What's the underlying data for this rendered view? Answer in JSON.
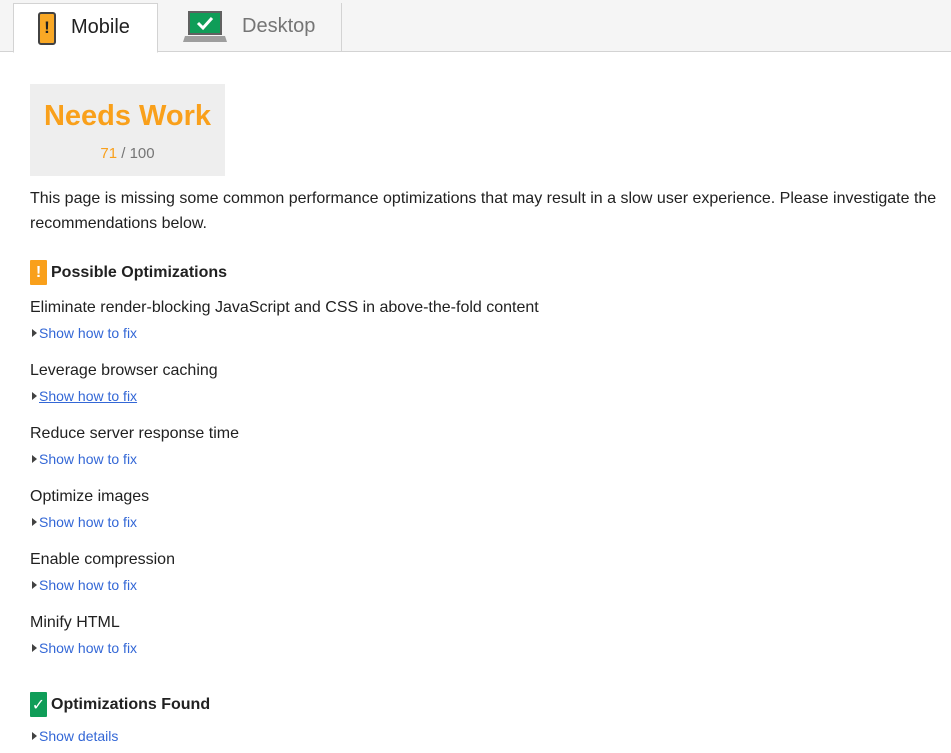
{
  "tabs": {
    "mobile_label": "Mobile",
    "desktop_label": "Desktop",
    "active": "mobile",
    "mobile_icon": "phone-warning-icon",
    "desktop_icon": "desktop-check-icon"
  },
  "score": {
    "title": "Needs Work",
    "value": "71",
    "max": "/ 100"
  },
  "description": "This page is missing some common performance optimizations that may result in a slow user experience. Please investigate the recommendations below.",
  "possible": {
    "badge": "!",
    "heading": "Possible Optimizations",
    "items": [
      {
        "title": "Eliminate render-blocking JavaScript and CSS in above-the-fold content",
        "link": "Show how to fix"
      },
      {
        "title": "Leverage browser caching",
        "link": "Show how to fix"
      },
      {
        "title": "Reduce server response time",
        "link": "Show how to fix"
      },
      {
        "title": "Optimize images",
        "link": "Show how to fix"
      },
      {
        "title": "Enable compression",
        "link": "Show how to fix"
      },
      {
        "title": "Minify HTML",
        "link": "Show how to fix"
      }
    ]
  },
  "found": {
    "badge": "✓",
    "heading": "Optimizations Found",
    "link": "Show details"
  },
  "colors": {
    "warning": "#f9a01b",
    "success": "#0f9d58",
    "link": "#3367d6"
  }
}
